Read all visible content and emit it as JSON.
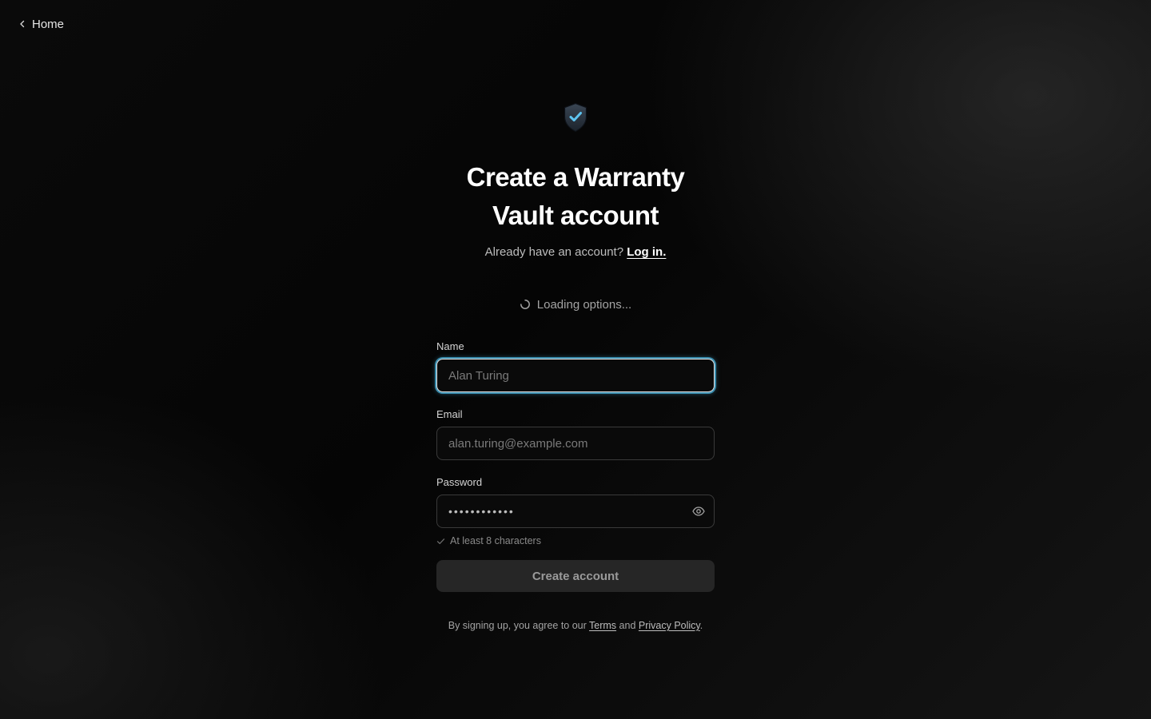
{
  "nav": {
    "back_label": "Home"
  },
  "header": {
    "logo_icon": "shield-check-icon",
    "title": "Create a Warranty Vault account",
    "subtitle_prefix": "Already have an account?",
    "login_link": "Log in."
  },
  "loading": {
    "text": "Loading options..."
  },
  "form": {
    "name": {
      "label": "Name",
      "placeholder": "Alan Turing",
      "value": ""
    },
    "email": {
      "label": "Email",
      "placeholder": "alan.turing@example.com",
      "value": ""
    },
    "password": {
      "label": "Password",
      "value": "••••••••••••",
      "toggle_icon": "eye-icon"
    },
    "requirements": [
      {
        "text": "At least 8 characters"
      }
    ],
    "submit_label": "Create account"
  },
  "legal": {
    "prefix": "By signing up, you agree to our",
    "terms": "Terms",
    "conjunction": "and",
    "privacy": "Privacy Policy",
    "suffix": "."
  },
  "colors": {
    "accent_focus": "#3b8fb0",
    "logo_check": "#5ec4f0",
    "button_bg": "#262626"
  }
}
